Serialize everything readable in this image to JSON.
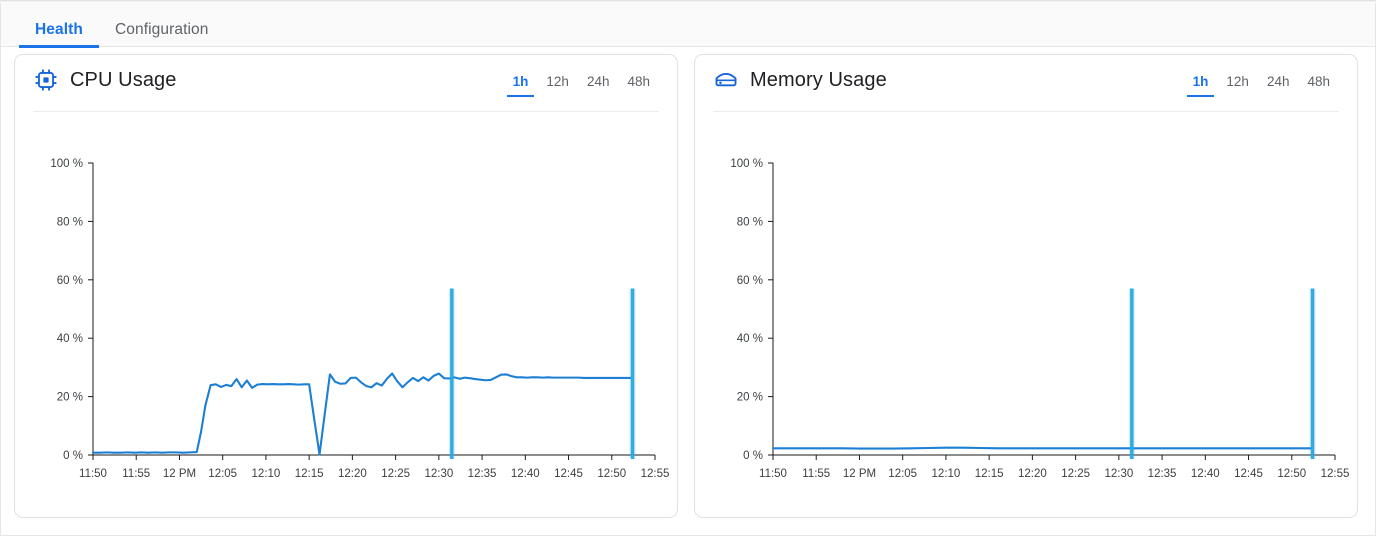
{
  "tabs": [
    {
      "label": "Health",
      "active": true
    },
    {
      "label": "Configuration",
      "active": false
    }
  ],
  "colors": {
    "accent": "#1a73e8",
    "series_line": "#1d7fd4",
    "marker": "#29a8e0",
    "axis": "#1a1a1a",
    "card_border": "#e0e2e4",
    "tabbar_bg": "#fafafa",
    "text_muted": "#5f6368",
    "text_primary": "#202124"
  },
  "cards": [
    {
      "id": "cpu",
      "title": "CPU Usage",
      "icon": "cpu-chip-icon",
      "ranges": [
        {
          "label": "1h",
          "active": true
        },
        {
          "label": "12h",
          "active": false
        },
        {
          "label": "24h",
          "active": false
        },
        {
          "label": "48h",
          "active": false
        }
      ]
    },
    {
      "id": "mem",
      "title": "Memory Usage",
      "icon": "memory-stick-icon",
      "ranges": [
        {
          "label": "1h",
          "active": true
        },
        {
          "label": "12h",
          "active": false
        },
        {
          "label": "24h",
          "active": false
        },
        {
          "label": "48h",
          "active": false
        }
      ]
    }
  ],
  "chart_data": [
    {
      "type": "line",
      "id": "cpu-usage-chart",
      "title": "CPU Usage",
      "xlabel": "",
      "ylabel": "",
      "ylim": [
        0,
        100
      ],
      "yticks": [
        0,
        20,
        40,
        60,
        80,
        100
      ],
      "ytick_labels": [
        "0 %",
        "20 %",
        "40 %",
        "60 %",
        "80 %",
        "100 %"
      ],
      "xticks": [
        "11:50",
        "11:55",
        "12 PM",
        "12:05",
        "12:10",
        "12:15",
        "12:20",
        "12:25",
        "12:30",
        "12:35",
        "12:40",
        "12:45",
        "12:50",
        "12:55"
      ],
      "grid": false,
      "legend": "none",
      "x": [
        0.0,
        0.8,
        1.6,
        2.4,
        3.2,
        4.0,
        4.8,
        5.6,
        6.4,
        7.2,
        8.0,
        8.8,
        9.6,
        10.4,
        11.2,
        12.0,
        12.5,
        13.0,
        13.6,
        14.2,
        14.8,
        15.4,
        16.0,
        16.6,
        17.2,
        17.8,
        18.4,
        19.0,
        19.6,
        20.2,
        20.8,
        21.4,
        22.0,
        22.6,
        23.2,
        23.8,
        24.4,
        25.0,
        25.6,
        26.2,
        26.8,
        27.4,
        28.0,
        28.6,
        29.2,
        29.8,
        30.4,
        31.0,
        31.6,
        32.2,
        32.8,
        33.4,
        34.0,
        34.6,
        35.2,
        35.8,
        36.4,
        37.0,
        37.6,
        38.2,
        38.8,
        39.4,
        40.0,
        40.6,
        41.2,
        41.8,
        42.4,
        43.0,
        43.6,
        44.2,
        44.8,
        45.4,
        46.0,
        46.6,
        47.2,
        47.8,
        48.4,
        49.0,
        49.6,
        50.2,
        50.8,
        51.4,
        52.0,
        52.6,
        53.2,
        53.8,
        54.4,
        55.0,
        55.6,
        56.2,
        56.8,
        57.4,
        58.0,
        58.6,
        59.2,
        59.8,
        60.4,
        61.0,
        61.6,
        62.2
      ],
      "y": [
        0.8,
        0.8,
        0.9,
        0.8,
        0.8,
        0.9,
        0.8,
        0.9,
        0.8,
        0.9,
        0.8,
        0.9,
        0.9,
        0.8,
        0.9,
        1.0,
        8.0,
        17.0,
        23.9,
        24.2,
        23.3,
        24.0,
        23.6,
        26.0,
        23.2,
        25.5,
        23.0,
        24.1,
        24.3,
        24.2,
        24.3,
        24.2,
        24.2,
        24.3,
        24.2,
        24.1,
        24.2,
        24.2,
        12.0,
        0.2,
        14.0,
        27.6,
        25.1,
        24.4,
        24.5,
        26.4,
        26.5,
        24.9,
        23.6,
        23.2,
        24.6,
        23.8,
        26.1,
        27.9,
        25.2,
        23.2,
        24.9,
        26.4,
        25.3,
        26.6,
        25.5,
        27.1,
        27.9,
        26.3,
        26.2,
        26.6,
        26.1,
        26.5,
        26.3,
        26.0,
        25.8,
        25.6,
        25.7,
        26.6,
        27.5,
        27.6,
        27.0,
        26.6,
        26.6,
        26.5,
        26.6,
        26.6,
        26.5,
        26.6,
        26.5,
        26.5,
        26.5,
        26.5,
        26.5,
        26.5,
        26.4,
        26.4,
        26.4,
        26.4,
        26.4,
        26.4,
        26.4,
        26.4,
        26.4,
        26.4
      ],
      "markers": [
        {
          "x": 41.5,
          "value": 57,
          "label": ""
        },
        {
          "x": 62.4,
          "value": 57,
          "label": ""
        }
      ],
      "x_domain": [
        0,
        65
      ]
    },
    {
      "type": "line",
      "id": "memory-usage-chart",
      "title": "Memory Usage",
      "xlabel": "",
      "ylabel": "",
      "ylim": [
        0,
        100
      ],
      "yticks": [
        0,
        20,
        40,
        60,
        80,
        100
      ],
      "ytick_labels": [
        "0 %",
        "20 %",
        "40 %",
        "60 %",
        "80 %",
        "100 %"
      ],
      "xticks": [
        "11:50",
        "11:55",
        "12 PM",
        "12:05",
        "12:10",
        "12:15",
        "12:20",
        "12:25",
        "12:30",
        "12:35",
        "12:40",
        "12:45",
        "12:50",
        "12:55"
      ],
      "grid": false,
      "legend": "none",
      "x": [
        0.0,
        2.0,
        4.0,
        6.0,
        8.0,
        10.0,
        12.0,
        14.0,
        16.0,
        18.0,
        20.0,
        22.0,
        24.0,
        26.0,
        28.0,
        30.0,
        32.0,
        34.0,
        36.0,
        38.0,
        40.0,
        42.0,
        44.0,
        46.0,
        48.0,
        50.0,
        52.0,
        54.0,
        56.0,
        58.0,
        60.0,
        62.2
      ],
      "y": [
        2.3,
        2.3,
        2.3,
        2.3,
        2.3,
        2.2,
        2.2,
        2.2,
        2.3,
        2.4,
        2.5,
        2.5,
        2.4,
        2.3,
        2.3,
        2.3,
        2.3,
        2.3,
        2.3,
        2.3,
        2.3,
        2.3,
        2.3,
        2.3,
        2.3,
        2.3,
        2.3,
        2.3,
        2.3,
        2.3,
        2.3,
        2.3
      ],
      "markers": [
        {
          "x": 41.5,
          "value": 57,
          "label": ""
        },
        {
          "x": 62.4,
          "value": 57,
          "label": ""
        }
      ],
      "x_domain": [
        0,
        65
      ]
    }
  ]
}
